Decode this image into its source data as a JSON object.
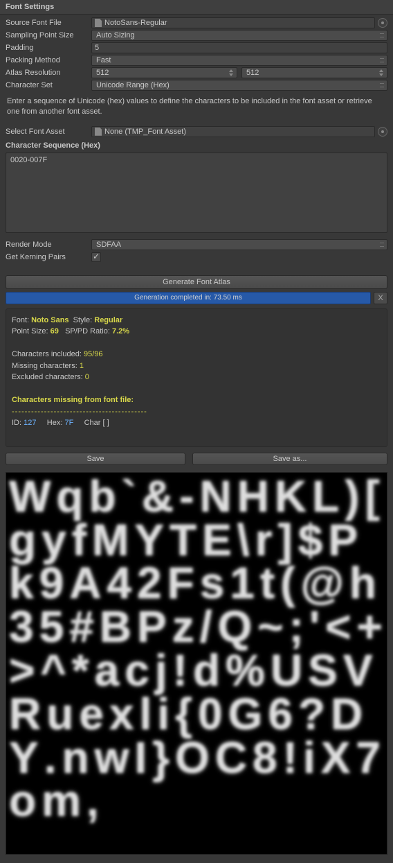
{
  "header": "Font Settings",
  "labels": {
    "sourceFontFile": "Source Font File",
    "samplingPointSize": "Sampling Point Size",
    "padding": "Padding",
    "packingMethod": "Packing Method",
    "atlasResolution": "Atlas Resolution",
    "characterSet": "Character Set",
    "selectFontAsset": "Select Font Asset",
    "characterSequence": "Character Sequence (Hex)",
    "renderMode": "Render Mode",
    "getKerningPairs": "Get Kerning Pairs"
  },
  "values": {
    "sourceFontFile": "NotoSans-Regular",
    "samplingPointSize": "Auto Sizing",
    "padding": "5",
    "packingMethod": "Fast",
    "atlasWidth": "512",
    "atlasHeight": "512",
    "characterSet": "Unicode Range (Hex)",
    "selectFontAsset": "None (TMP_Font Asset)",
    "characterSequence": "0020-007F",
    "renderMode": "SDFAA",
    "getKerningPairs": true
  },
  "infoText": "Enter a sequence of Unicode (hex) values to define the characters to be included in the font asset or retrieve one from another font asset.",
  "buttons": {
    "generate": "Generate Font Atlas",
    "save": "Save",
    "saveAs": "Save as...",
    "close": "X"
  },
  "progress": "Generation completed in: 73.50 ms",
  "report": {
    "fontLabel": "Font:",
    "fontName": "Noto Sans",
    "styleLabel": "Style:",
    "styleValue": "Regular",
    "pointSizeLabel": "Point Size:",
    "pointSize": "69",
    "ratioLabel": "SP/PD Ratio:",
    "ratio": "7.2%",
    "charsIncludedLabel": "Characters included:",
    "charsIncluded": "95/96",
    "missingLabel": "Missing characters:",
    "missing": "1",
    "excludedLabel": "Excluded characters:",
    "excluded": "0",
    "missingHeader": "Characters missing from font file:",
    "idLabel": "ID:",
    "idValue": "127",
    "hexLabel": "Hex:",
    "hexValue": "7F",
    "charLabel": "Char [ ]"
  },
  "atlasGlyphs": "Wqb`&-NHKL)[gyfMYTE\\r]$Pk9A42Fs1t(@h35#BPz/Q~;'<+>^*acj!d%USVRuexli{0G6?DY.nwI}OC8!iX7om,"
}
